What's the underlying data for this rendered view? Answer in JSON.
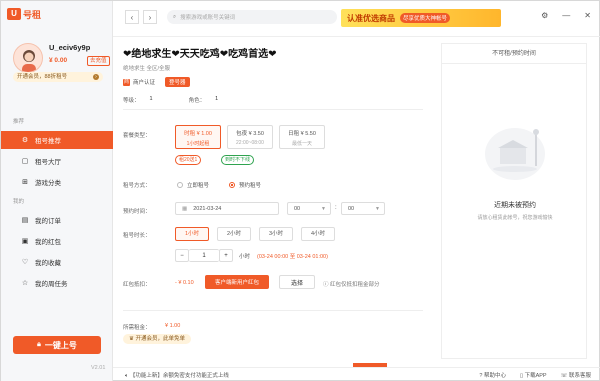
{
  "app": {
    "logo_badge": "U",
    "logo_text": "号租"
  },
  "user": {
    "name": "U_eciv6y9p",
    "balance": "¥ 0.00",
    "recharge": "去充值",
    "vip_text": "开通会员，88折租号"
  },
  "sidebar": {
    "section_recommend": "推荐",
    "items": [
      {
        "label": "租号推荐",
        "icon": "gear-icon",
        "active": true
      },
      {
        "label": "租号大厅",
        "icon": "chat-icon"
      },
      {
        "label": "游戏分类",
        "icon": "grid-icon"
      }
    ],
    "section_mine": "我的",
    "mine_items": [
      {
        "label": "我的订单",
        "icon": "order-icon"
      },
      {
        "label": "我的红包",
        "icon": "redpacket-icon"
      },
      {
        "label": "我的收藏",
        "icon": "heart-icon"
      },
      {
        "label": "我的周任务",
        "icon": "task-icon"
      }
    ],
    "main_button": "一键上号",
    "version": "V2.01"
  },
  "topbar": {
    "search_placeholder": "搜索游戏或账号关键词",
    "banner_title": "认准优选商品",
    "banner_sub": "尽享优质大神帐号"
  },
  "product": {
    "title": "❤绝地求生❤天天吃鸡❤吃鸡首选❤",
    "subtitle": "绝地求生 全区/全服",
    "merchant_tag": "商户认证",
    "login_tag": "登号器",
    "level_label": "等级：",
    "level_value": "1",
    "role_label": "角色：",
    "role_value": "1"
  },
  "packages": {
    "label": "套餐类型：",
    "options": [
      {
        "name": "时租 ¥ 1.00",
        "desc": "1小时起租",
        "selected": true
      },
      {
        "name": "包夜 ¥ 3.50",
        "desc": "22:00~08:00"
      },
      {
        "name": "日租 ¥ 5.50",
        "desc": "最低一天"
      }
    ],
    "tag1": "租20送1",
    "tag2": "到时不下线"
  },
  "rent_mode": {
    "label": "租号方式：",
    "opt1": "立即租号",
    "opt2": "预约租号"
  },
  "schedule": {
    "label": "预约时间：",
    "date": "2021-03-24",
    "hour": "00",
    "minute": "00",
    "sep": ":"
  },
  "duration": {
    "label": "租号时长：",
    "options": [
      "1小时",
      "2小时",
      "3小时",
      "4小时"
    ],
    "qty": "1",
    "unit": "小时",
    "range": "(03-24 00:00 至 03-24 01:00)",
    "minus": "−",
    "plus": "+"
  },
  "redpacket": {
    "label": "红包抵扣：",
    "amount": "- ¥ 0.10",
    "btn_new": "客户端新用户红包",
    "btn_choose": "选择",
    "note": "红包仅抵扣租金部分"
  },
  "total": {
    "label": "所需租金：",
    "value": "¥ 1.00",
    "vip_note": "开通会员，此单免单"
  },
  "panel": {
    "head": "不可租/预约时间",
    "empty_title": "近期未被预约",
    "empty_desc": "请放心租赁此帐号，祝您游戏愉快"
  },
  "statusbar": {
    "news": "【功能上新】余额免密支付功能正式上线",
    "help": "帮助中心",
    "download": "下载APP",
    "service": "联系客服"
  }
}
